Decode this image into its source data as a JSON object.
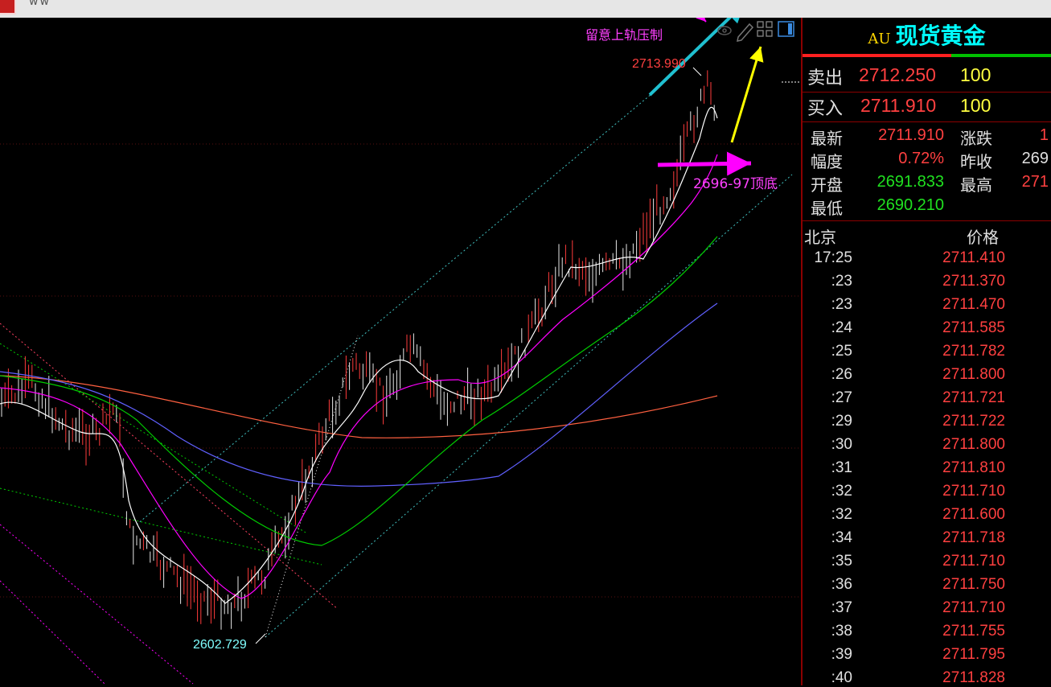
{
  "window": {
    "title_glyph": "ww"
  },
  "symbol": {
    "code": "AU",
    "name": "现货黄金"
  },
  "order_book": {
    "sell_label": "卖出",
    "sell_price": "2712.250",
    "sell_volume": "100",
    "buy_label": "买入",
    "buy_price": "2711.910",
    "buy_volume": "100"
  },
  "stats": {
    "latest_label": "最新",
    "latest_value": "2711.910",
    "change_label": "涨跌",
    "change_value": "1",
    "amplitude_label": "幅度",
    "amplitude_value": "0.72%",
    "prev_close_label": "昨收",
    "prev_close_value": "269",
    "open_label": "开盘",
    "open_value": "2691.833",
    "high_label": "最高",
    "high_value": "271",
    "low_label": "最低",
    "low_value": "2690.210"
  },
  "ticks": {
    "time_header": "北京",
    "price_header": "价格",
    "rows": [
      {
        "time": "17:25",
        "price": "2711.410"
      },
      {
        "time": ":23",
        "price": "2711.370"
      },
      {
        "time": ":23",
        "price": "2711.470"
      },
      {
        "time": ":24",
        "price": "2711.585"
      },
      {
        "time": ":25",
        "price": "2711.782"
      },
      {
        "time": ":26",
        "price": "2711.800"
      },
      {
        "time": ":27",
        "price": "2711.721"
      },
      {
        "time": ":29",
        "price": "2711.722"
      },
      {
        "time": ":30",
        "price": "2711.800"
      },
      {
        "time": ":31",
        "price": "2711.810"
      },
      {
        "time": ":32",
        "price": "2711.710"
      },
      {
        "time": ":32",
        "price": "2711.600"
      },
      {
        "time": ":34",
        "price": "2711.718"
      },
      {
        "time": ":35",
        "price": "2711.710"
      },
      {
        "time": ":36",
        "price": "2711.750"
      },
      {
        "time": ":37",
        "price": "2711.710"
      },
      {
        "time": ":38",
        "price": "2711.755"
      },
      {
        "time": ":39",
        "price": "2711.795"
      },
      {
        "time": ":40",
        "price": "2711.828"
      }
    ]
  },
  "chart": {
    "high_marker": "2713.990",
    "low_marker": "2602.729",
    "annotation_upper_rail": "留意上轨压制",
    "annotation_support": "2696-97顶底",
    "toolbar_icons": [
      "eye-icon",
      "pencil-icon",
      "grid-icon",
      "panel-toggle-icon"
    ],
    "colors": {
      "up": "#ff3b3b",
      "down": "#e8e8e8",
      "ma_fast": "#ffffff",
      "ma_mid": "#ff00ff",
      "ma_slow": "#00cc00",
      "ma_long": "#6060ff",
      "ma_longest": "#ff6040",
      "channel": "#40c0c0",
      "arrow_cyan": "#20c0d0",
      "arrow_yellow": "#ffff00",
      "arrow_magenta": "#ff00ff"
    }
  }
}
